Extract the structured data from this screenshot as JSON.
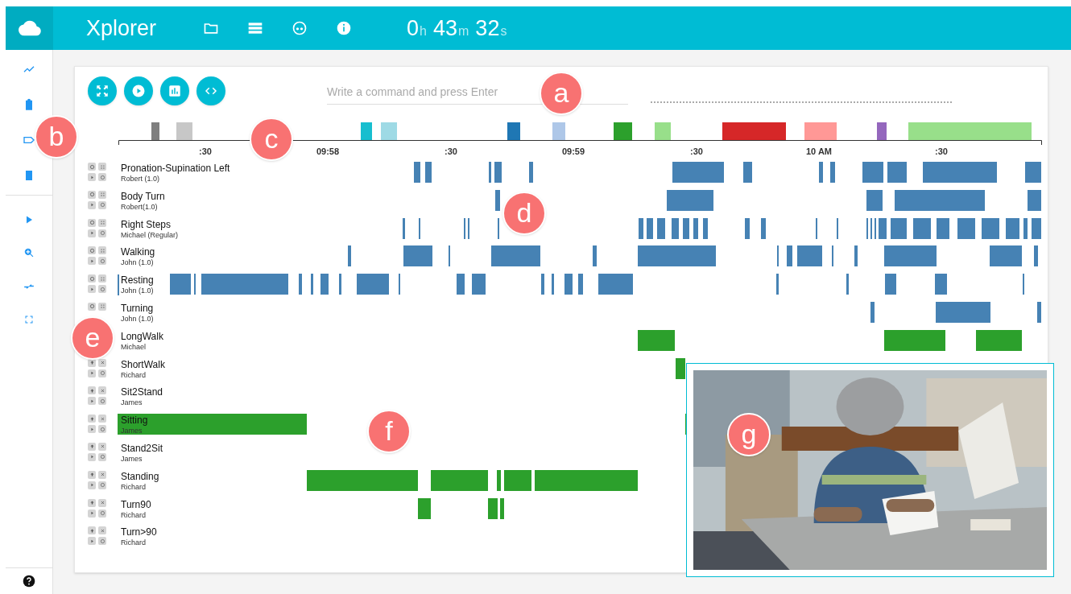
{
  "header": {
    "title": "Xplorer",
    "timer": [
      {
        "value": "0",
        "unit": "h"
      },
      {
        "value": "43",
        "unit": "m"
      },
      {
        "value": "32",
        "unit": "s"
      }
    ]
  },
  "command": {
    "placeholder": "Write a command and press Enter"
  },
  "axis_ticks": [
    ":30",
    "09:58",
    ":30",
    "09:59",
    ":30",
    "10 AM",
    ":30"
  ],
  "tracks": [
    {
      "name": "Pronation-Supination Left",
      "annotator": "Robert (1.0)",
      "kind": "signal",
      "selected": false
    },
    {
      "name": "Body Turn",
      "annotator": "Robert(1.0)",
      "kind": "signal",
      "selected": false
    },
    {
      "name": "Right Steps",
      "annotator": "Michael (Regular)",
      "kind": "signal",
      "selected": false
    },
    {
      "name": "Walking",
      "annotator": "John (1.0)",
      "kind": "signal",
      "selected": false
    },
    {
      "name": "Resting",
      "annotator": "John (1.0)",
      "kind": "signal",
      "selected": true
    },
    {
      "name": "Turning",
      "annotator": "John (1.0)",
      "kind": "signal",
      "selected": false
    },
    {
      "name": "LongWalk",
      "annotator": "Michael",
      "kind": "label",
      "selected": false
    },
    {
      "name": "ShortWalk",
      "annotator": "Richard",
      "kind": "label",
      "selected": false
    },
    {
      "name": "Sit2Stand",
      "annotator": "James",
      "kind": "label",
      "selected": false
    },
    {
      "name": "Sitting",
      "annotator": "James",
      "kind": "label",
      "selected": false
    },
    {
      "name": "Stand2Sit",
      "annotator": "James",
      "kind": "label",
      "selected": false
    },
    {
      "name": "Standing",
      "annotator": "Richard",
      "kind": "label",
      "selected": false
    },
    {
      "name": "Turn90",
      "annotator": "Richard",
      "kind": "label",
      "selected": false
    },
    {
      "name": "Turn>90",
      "annotator": "Richard",
      "kind": "label",
      "selected": false
    }
  ],
  "callouts": [
    "a",
    "b",
    "c",
    "d",
    "e",
    "f",
    "g"
  ]
}
